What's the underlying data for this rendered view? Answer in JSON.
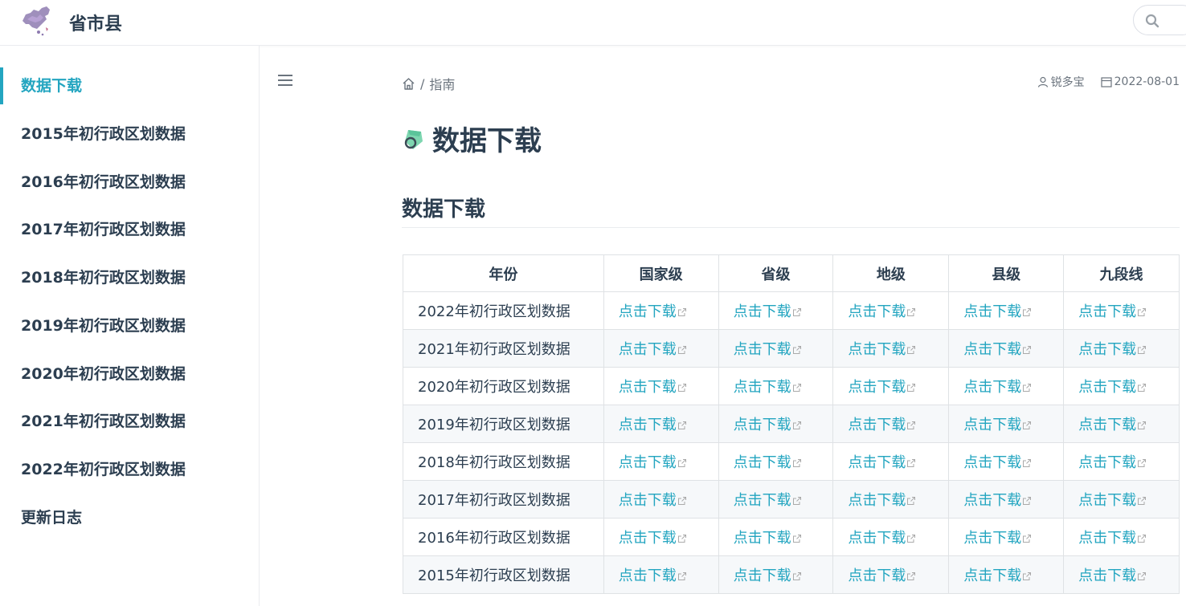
{
  "site": {
    "title": "省市县"
  },
  "sidebar": {
    "items": [
      {
        "label": "数据下载",
        "active": true
      },
      {
        "label": "2015年初行政区划数据"
      },
      {
        "label": "2016年初行政区划数据"
      },
      {
        "label": "2017年初行政区划数据"
      },
      {
        "label": "2018年初行政区划数据"
      },
      {
        "label": "2019年初行政区划数据"
      },
      {
        "label": "2020年初行政区划数据"
      },
      {
        "label": "2021年初行政区划数据"
      },
      {
        "label": "2022年初行政区划数据"
      },
      {
        "label": "更新日志"
      }
    ]
  },
  "breadcrumb": {
    "separator": "/",
    "current": "指南"
  },
  "meta": {
    "author": "锐多宝",
    "date": "2022-08-01"
  },
  "page": {
    "title": "数据下载",
    "section_title": "数据下载"
  },
  "table": {
    "headers": [
      "年份",
      "国家级",
      "省级",
      "地级",
      "县级",
      "九段线"
    ],
    "link_label": "点击下载",
    "rows": [
      {
        "year": "2022年初行政区划数据"
      },
      {
        "year": "2021年初行政区划数据"
      },
      {
        "year": "2020年初行政区划数据"
      },
      {
        "year": "2019年初行政区划数据"
      },
      {
        "year": "2018年初行政区划数据"
      },
      {
        "year": "2017年初行政区划数据"
      },
      {
        "year": "2016年初行政区划数据"
      },
      {
        "year": "2015年初行政区划数据"
      }
    ]
  },
  "icons": {
    "logo": "china-map-logo-icon",
    "search": "search-icon",
    "menu": "hamburger-menu-icon",
    "home": "home-icon",
    "user": "user-icon",
    "calendar": "calendar-icon",
    "title": "tag-icon",
    "external": "external-link-icon"
  },
  "colors": {
    "accent": "#23a5c0",
    "text": "#2c3e50",
    "muted": "#6a737d"
  }
}
